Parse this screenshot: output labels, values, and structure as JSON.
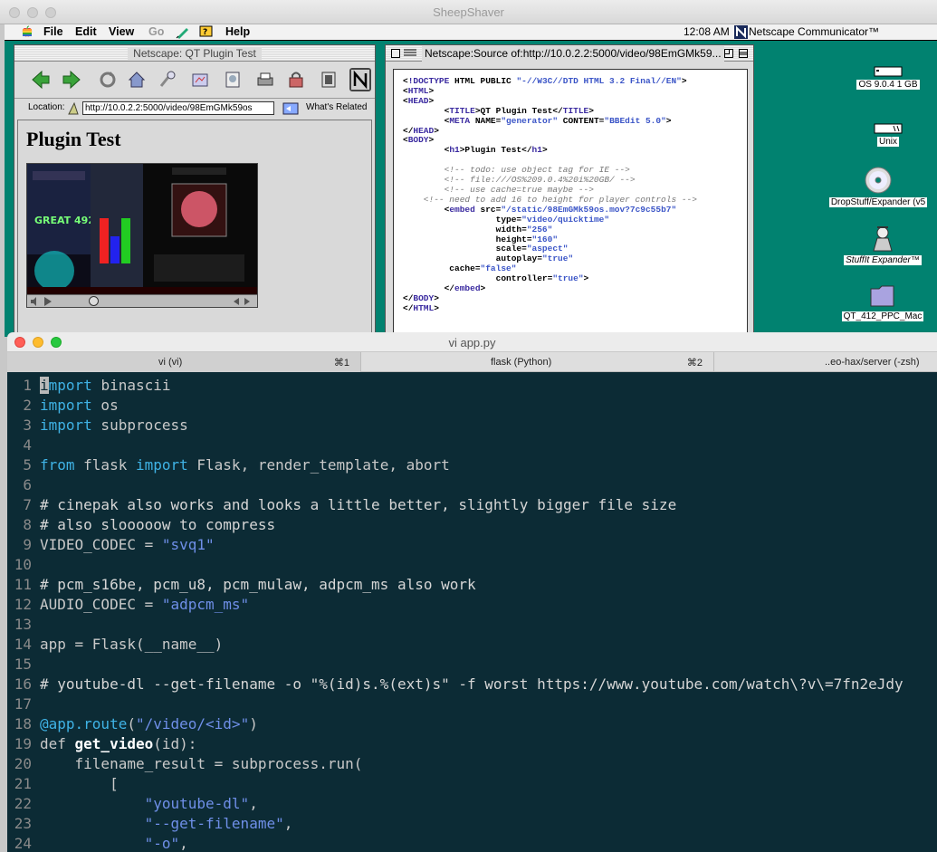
{
  "outer_window": {
    "title": "SheepShaver"
  },
  "menubar": {
    "items": [
      "File",
      "Edit",
      "View",
      "Go",
      "Help"
    ],
    "clock": "12:08 AM",
    "active_app": "Netscape Communicator™"
  },
  "browser": {
    "title": "Netscape: QT Plugin Test",
    "location_label": "Location:",
    "url": "http://10.0.2.2:5000/video/98EmGMk59os",
    "whats_related": "What's Related",
    "heading": "Plugin Test"
  },
  "source_window": {
    "title": "Netscape:Source of:http://10.0.2.2:5000/video/98EmGMk59...",
    "lines": [
      "<!DOCTYPE HTML PUBLIC \"-//W3C//DTD HTML 3.2 Final//EN\">",
      "<HTML>",
      "<HEAD>",
      "        <TITLE>QT Plugin Test</TITLE>",
      "        <META NAME=\"generator\" CONTENT=\"BBEdit 5.0\">",
      "</HEAD>",
      "<BODY>",
      "        <h1>Plugin Test</h1>",
      "",
      "        <!-- todo: use object tag for IE -->",
      "        <!-- file:///OS%209.0.4%20i%20GB/ -->",
      "        <!-- use cache=true maybe -->",
      "    <!-- need to add 16 to height for player controls -->",
      "        <embed src=\"/static/98EmGMk59os.mov?7c9c55b7\"",
      "                  type=\"video/quicktime\"",
      "                  width=\"256\"",
      "                  height=\"160\"",
      "                  scale=\"aspect\"",
      "                  autoplay=\"true\"",
      "         cache=\"false\"",
      "                  controller=\"true\">",
      "        </embed>",
      "</BODY>",
      "</HTML>"
    ]
  },
  "desktop_icons": [
    {
      "label": "OS 9.0.4 1 GB",
      "icon": "hard-disk-icon"
    },
    {
      "label": "Unix",
      "icon": "hard-disk-icon"
    },
    {
      "label": "DropStuff/Expander (v5",
      "icon": "cd-icon"
    },
    {
      "label": "StuffIt Expander™",
      "icon": "stuffit-icon"
    },
    {
      "label": "QT_412_PPC_Mac",
      "icon": "folder-icon"
    }
  ],
  "terminal": {
    "title": "vi app.py",
    "tabs": [
      {
        "label": "vi (vi)",
        "shortcut": "⌘1"
      },
      {
        "label": "flask (Python)",
        "shortcut": "⌘2"
      },
      {
        "label": "..eo-hax/server (-zsh)",
        "shortcut": ""
      }
    ],
    "code_lines": [
      "import binascii",
      "import os",
      "import subprocess",
      "",
      "from flask import Flask, render_template, abort",
      "",
      "# cinepak also works and looks a little better, slightly bigger file size",
      "# also slooooow to compress",
      "VIDEO_CODEC = \"svq1\"",
      "",
      "# pcm_s16be, pcm_u8, pcm_mulaw, adpcm_ms also work",
      "AUDIO_CODEC = \"adpcm_ms\"",
      "",
      "app = Flask(__name__)",
      "",
      "# youtube-dl --get-filename -o \"%(id)s.%(ext)s\" -f worst https://www.youtube.com/watch\\?v\\=7fn2eJdy",
      "",
      "@app.route(\"/video/<id>\")",
      "def get_video(id):",
      "    filename_result = subprocess.run(",
      "        [",
      "            \"youtube-dl\",",
      "            \"--get-filename\",",
      "            \"-o\","
    ]
  },
  "colors": {
    "desktop": "#018270",
    "terminal_bg": "#0c2b35",
    "keyword": "#3fb3e6",
    "string": "#6f8fe8"
  }
}
